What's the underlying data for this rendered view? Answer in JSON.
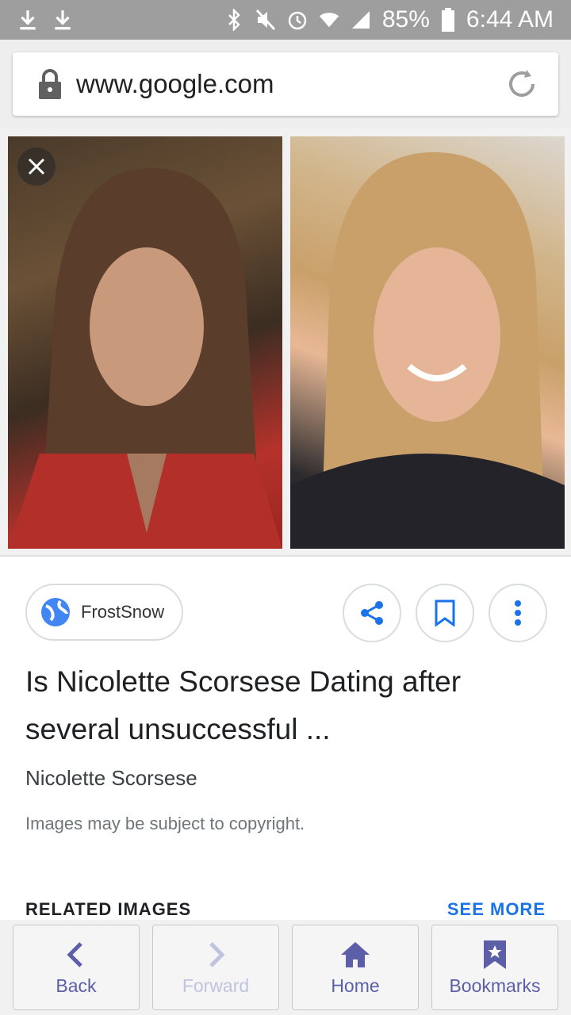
{
  "status_bar": {
    "battery": "85%",
    "time": "6:44 AM",
    "icons": [
      "download-icon",
      "download-icon",
      "bluetooth-icon",
      "mute-icon",
      "alarm-icon",
      "wifi-icon",
      "signal-icon",
      "battery-icon"
    ]
  },
  "browser": {
    "url": "www.google.com",
    "icons": [
      "lock-icon",
      "reload-icon"
    ]
  },
  "image_viewer": {
    "images": [
      {
        "desc": "woman with long brown hair in red top"
      },
      {
        "desc": "smiling woman with long blonde hair"
      }
    ]
  },
  "result": {
    "source": "FrostSnow",
    "title": "Is Nicolette Scorsese Dating after several unsuccessful ...",
    "subtitle": "Nicolette Scorsese",
    "copyright": "Images may be subject to copyright.",
    "actions": [
      "share-icon",
      "bookmark-icon",
      "more-vert-icon"
    ]
  },
  "related": {
    "heading": "RELATED IMAGES",
    "see_more": "SEE MORE"
  },
  "nav": {
    "back": "Back",
    "forward": "Forward",
    "home": "Home",
    "bookmarks": "Bookmarks"
  },
  "colors": {
    "accent": "#1a73e8",
    "nav_text": "#5c5fa8",
    "status_bar": "#9e9e9e"
  }
}
